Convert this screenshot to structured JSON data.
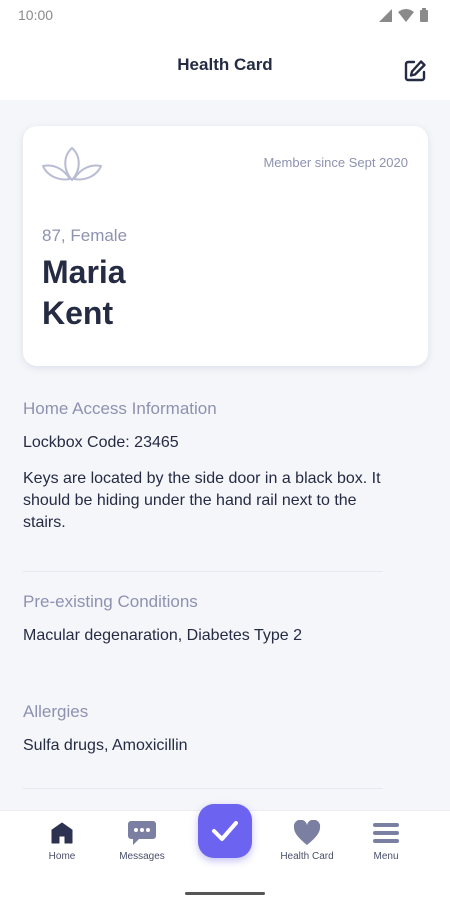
{
  "status_bar": {
    "time": "10:00",
    "icons": [
      "signal-icon",
      "wifi-icon",
      "battery-icon"
    ]
  },
  "header": {
    "title": "Health Card",
    "edit_icon": "edit-icon"
  },
  "card": {
    "logo_icon": "lotus-logo-icon",
    "member_since": "Member since Sept 2020",
    "age_gender": "87, Female",
    "first_name": "Maria",
    "last_name": "Kent"
  },
  "sections": {
    "home_access": {
      "title": "Home Access Information",
      "lockbox": "Lockbox Code: 23465",
      "note": "Keys are located by the side door in a black box. It should be hiding under the hand rail next to the stairs."
    },
    "conditions": {
      "title": "Pre-existing Conditions",
      "text": "Macular degenaration, Diabetes Type 2"
    },
    "allergies": {
      "title": "Allergies",
      "text": "Sulfa drugs, Amoxicillin"
    }
  },
  "bottom_nav": {
    "items": [
      {
        "label": "Home",
        "icon": "home-icon"
      },
      {
        "label": "Messages",
        "icon": "chat-icon"
      },
      {
        "label": "Health Card",
        "icon": "heart-icon"
      },
      {
        "label": "Menu",
        "icon": "menu-icon"
      }
    ],
    "fab_icon": "check-icon"
  },
  "colors": {
    "accent": "#6c63f0",
    "text_dark": "#252b42",
    "text_muted": "#8e92b0",
    "nav_icon": "#2d3250",
    "nav_icon_muted": "#7b80a3",
    "background": "#f5f6fa"
  }
}
